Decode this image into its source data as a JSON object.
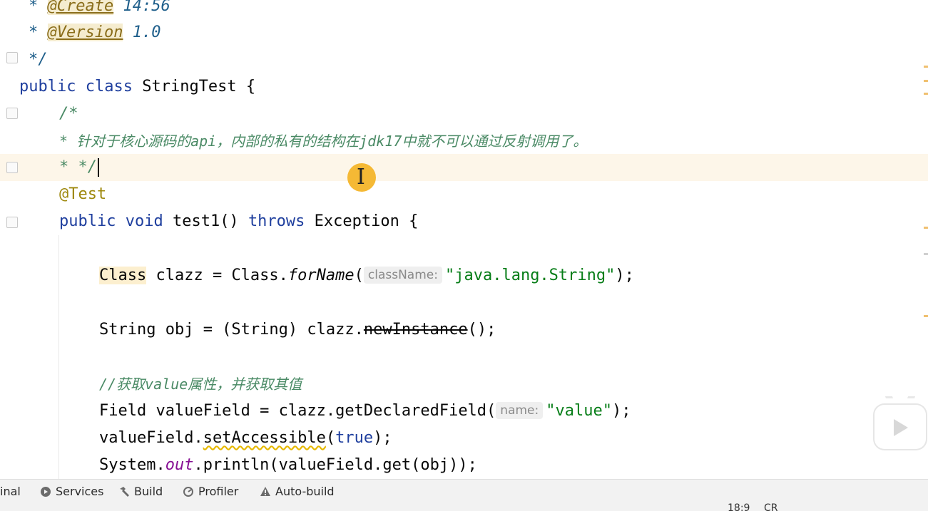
{
  "editor": {
    "lines": {
      "l1": {
        "star": "* ",
        "tag": "@Create",
        "rest": " 14:56"
      },
      "l2": {
        "star": "* ",
        "tag": "@Version",
        "rest": " 1.0"
      },
      "l3": "*/",
      "l4": {
        "kw1": "public",
        "kw2": "class",
        "name": " StringTest {"
      },
      "l5": "/*",
      "l6": "* 针对于核心源码的api，内部的私有的结构在jdk17中就不可以通过反射调用了。",
      "l7": "* */",
      "l8": "@Test",
      "l9": {
        "kw1": "public",
        "kw2": "void",
        "name": " test1() ",
        "kw3": "throws",
        "rest": " Exception {"
      },
      "l10": {
        "hl": "Class",
        "mid": " clazz = Class.",
        "method": "forName",
        "open": "(",
        "hint": "className:",
        "str": "\"java.lang.String\"",
        "close": ");"
      },
      "l11": {
        "pre": "String obj = (String) clazz.",
        "deprecated": "newInstance",
        "post": "();"
      },
      "l12": "//获取value属性，并获取其值",
      "l13": {
        "pre": "Field valueField = clazz.getDeclaredField(",
        "hint": "name:",
        "str": "\"value\"",
        "post": ");"
      },
      "l14": {
        "pre": "valueField.",
        "warn": "setAccessible",
        "open": "(",
        "kw": "true",
        "post": ");"
      },
      "l15": {
        "pre": "System.",
        "static": "out",
        "post": ".println(valueField.get(obj));"
      }
    }
  },
  "toolwindows": {
    "terminal": "inal",
    "services": "Services",
    "build": "Build",
    "profiler": "Profiler",
    "autobuild": "Auto-build"
  },
  "statusbar": {
    "position": "18:9",
    "encoding": "CR"
  },
  "colors": {
    "caret_row": "#fdf6e9",
    "cursor_marker": "#f5b935",
    "keyword": "#1f3f9e",
    "string": "#067d17",
    "comment": "#4a8a65",
    "annotation": "#9e880d"
  },
  "icons": [
    "services-icon",
    "hammer-icon",
    "profiler-icon",
    "warning-triangle-icon",
    "play-icon"
  ]
}
